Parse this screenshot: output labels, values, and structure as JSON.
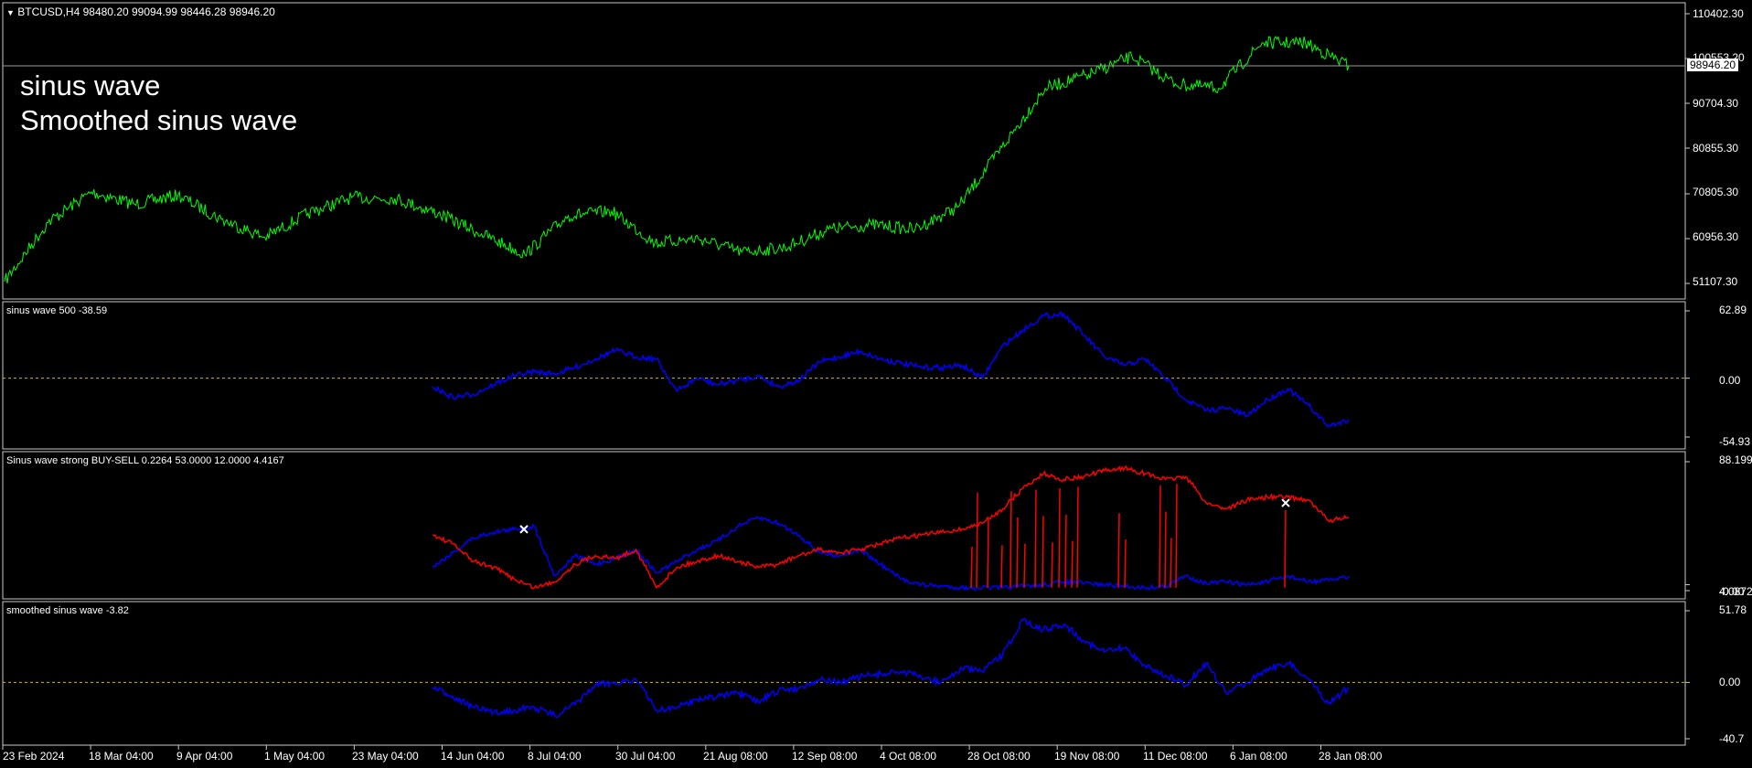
{
  "window": {
    "symbol_line": "BTCUSD,H4  98480.20 99094.99 98446.28 98946.20",
    "overlay_lines": [
      "sinus wave",
      "Smoothed sinus wave"
    ]
  },
  "colors": {
    "background": "#000000",
    "price_line": "#00ff00",
    "blue_line": "#0000ff",
    "red_line": "#ff0000",
    "zero_line": "#d8b800",
    "frame": "#c8c8c8"
  },
  "current_price": "98946.20",
  "price_label_hidden": "100553.20",
  "x_labels": [
    "23 Feb 2024",
    "18 Mar 04:00",
    "9 Apr 04:00",
    "1 May 04:00",
    "23 May 04:00",
    "14 Jun 04:00",
    "8 Jul 04:00",
    "30 Jul 04:00",
    "21 Aug 08:00",
    "12 Sep 08:00",
    "4 Oct 08:00",
    "28 Oct 08:00",
    "19 Nov 08:00",
    "11 Dec 08:00",
    "6 Jan 08:00",
    "28 Jan 08:00"
  ],
  "chart_data": [
    {
      "type": "line",
      "title": "BTCUSD,H4  98480.20 99094.99 98446.28 98946.20",
      "y_ticks": [
        "110402.30",
        "100553.20",
        "90704.30",
        "80855.30",
        "70805.30",
        "60956.30",
        "51107.30"
      ],
      "ylim": [
        51107.3,
        110402.3
      ],
      "series": [
        {
          "name": "BTCUSD",
          "color": "#00ff00",
          "x": [
            "23 Feb 2024",
            "5 Mar",
            "18 Mar",
            "28 Mar",
            "9 Apr",
            "20 Apr",
            "1 May",
            "12 May",
            "23 May",
            "3 Jun",
            "14 Jun",
            "25 Jun",
            "8 Jul",
            "19 Jul",
            "30 Jul",
            "10 Aug",
            "21 Aug",
            "1 Sep",
            "12 Sep",
            "23 Sep",
            "4 Oct",
            "16 Oct",
            "28 Oct",
            "9 Nov",
            "19 Nov",
            "30 Nov",
            "11 Dec",
            "24 Dec",
            "6 Jan",
            "17 Jan",
            "28 Jan",
            "3 Feb"
          ],
          "values": [
            51500,
            64500,
            71200,
            68500,
            70500,
            65200,
            61200,
            66500,
            70000,
            69800,
            66500,
            62000,
            57500,
            66000,
            67000,
            60000,
            61000,
            58000,
            59000,
            63000,
            64000,
            63000,
            68000,
            81000,
            94000,
            97000,
            101000,
            95000,
            94000,
            104000,
            104000,
            98946
          ]
        }
      ]
    },
    {
      "type": "line",
      "title": "sinus wave 500 -38.59",
      "y_ticks": [
        "62.89",
        "0.00",
        "-54.93"
      ],
      "ylim": [
        -54.93,
        62.89
      ],
      "reference_line": 0,
      "series": [
        {
          "name": "sinus wave",
          "color": "#0000ff",
          "x": [
            "12 Jun",
            "16 Jun",
            "21 Jun",
            "24 Jun",
            "28 Jun",
            "3 Jul",
            "8 Jul",
            "13 Jul",
            "17 Jul",
            "22 Jul",
            "27 Jul",
            "30 Jul",
            "4 Aug",
            "10 Aug",
            "16 Aug",
            "21 Aug",
            "27 Aug",
            "3 Sep",
            "8 Sep",
            "14 Sep",
            "21 Sep",
            "28 Sep",
            "4 Oct",
            "10 Oct",
            "17 Oct",
            "22 Oct",
            "28 Oct",
            "1 Nov",
            "8 Nov",
            "15 Nov",
            "19 Nov",
            "26 Nov",
            "1 Dec",
            "5 Dec",
            "11 Dec",
            "17 Dec",
            "24 Dec",
            "31 Dec",
            "6 Jan",
            "10 Jan",
            "15 Jan",
            "20 Jan",
            "25 Jan",
            "29 Jan",
            "1 Feb",
            "3 Feb"
          ],
          "values": [
            -8,
            -18,
            -15,
            -6,
            2,
            6,
            4,
            10,
            18,
            26,
            20,
            18,
            -12,
            0,
            -6,
            -2,
            2,
            -8,
            -2,
            15,
            20,
            25,
            18,
            14,
            10,
            10,
            12,
            0,
            30,
            45,
            58,
            60,
            40,
            20,
            12,
            18,
            0,
            -20,
            -30,
            -28,
            -35,
            -20,
            -10,
            -25,
            -45,
            -38.59
          ]
        }
      ]
    },
    {
      "type": "line",
      "title": "Sinus wave strong BUY-SELL 0.2264 53.0000 12.0000 4.4167",
      "y_ticks": [
        "88.1994",
        "4.0872",
        "-0.00"
      ],
      "ylim": [
        -0.0,
        88.1994
      ],
      "series": [
        {
          "name": "blue",
          "color": "#0000ff",
          "x": [
            "12 Jun",
            "16 Jun",
            "21 Jun",
            "24 Jun",
            "28 Jun",
            "3 Jul",
            "8 Jul",
            "13 Jul",
            "17 Jul",
            "22 Jul",
            "27 Jul",
            "30 Jul",
            "4 Aug",
            "10 Aug",
            "16 Aug",
            "21 Aug",
            "27 Aug",
            "3 Sep",
            "8 Sep",
            "14 Sep",
            "21 Sep",
            "28 Sep",
            "4 Oct",
            "10 Oct",
            "17 Oct",
            "22 Oct",
            "28 Oct",
            "1 Nov",
            "8 Nov",
            "15 Nov",
            "19 Nov",
            "26 Nov",
            "1 Dec",
            "5 Dec",
            "11 Dec",
            "17 Dec",
            "24 Dec",
            "31 Dec",
            "6 Jan",
            "10 Jan",
            "15 Jan",
            "20 Jan",
            "25 Jan",
            "29 Jan",
            "1 Feb",
            "3 Feb"
          ],
          "values": [
            16,
            26,
            36,
            40,
            42,
            44,
            10,
            24,
            18,
            22,
            28,
            12,
            20,
            28,
            34,
            44,
            50,
            46,
            38,
            26,
            24,
            28,
            18,
            8,
            4,
            3,
            2,
            2,
            2,
            3,
            4,
            6,
            5,
            4,
            3,
            2,
            3,
            10,
            5,
            6,
            4,
            6,
            10,
            6,
            7,
            10
          ]
        },
        {
          "name": "red",
          "color": "#ff0000",
          "x": [
            "12 Jun",
            "16 Jun",
            "21 Jun",
            "24 Jun",
            "28 Jun",
            "3 Jul",
            "8 Jul",
            "13 Jul",
            "17 Jul",
            "22 Jul",
            "27 Jul",
            "30 Jul",
            "4 Aug",
            "10 Aug",
            "16 Aug",
            "21 Aug",
            "27 Aug",
            "3 Sep",
            "8 Sep",
            "14 Sep",
            "21 Sep",
            "28 Sep",
            "4 Oct",
            "10 Oct",
            "17 Oct",
            "22 Oct",
            "28 Oct",
            "1 Nov",
            "8 Nov",
            "15 Nov",
            "19 Nov",
            "26 Nov",
            "1 Dec",
            "5 Dec",
            "11 Dec",
            "17 Dec",
            "24 Dec",
            "31 Dec",
            "6 Jan",
            "10 Jan",
            "15 Jan",
            "20 Jan",
            "25 Jan",
            "29 Jan",
            "1 Feb",
            "3 Feb"
          ],
          "values": [
            38,
            32,
            20,
            16,
            8,
            2,
            6,
            18,
            24,
            22,
            28,
            2,
            16,
            20,
            24,
            20,
            16,
            18,
            24,
            28,
            26,
            28,
            32,
            36,
            38,
            40,
            42,
            46,
            56,
            70,
            80,
            76,
            78,
            82,
            84,
            80,
            76,
            78,
            60,
            56,
            62,
            64,
            64,
            62,
            48,
            50
          ]
        }
      ],
      "markers": [
        {
          "x": "7 Jul",
          "value": 42,
          "symbol": "x"
        },
        {
          "x": "13 Jan",
          "value": 60,
          "symbol": "x"
        }
      ]
    },
    {
      "type": "line",
      "title": "smoothed sinus wave -3.82",
      "y_ticks": [
        "51.78",
        "0.00",
        "-40.7"
      ],
      "ylim": [
        -40.7,
        51.78
      ],
      "reference_line": 0,
      "series": [
        {
          "name": "smoothed sinus wave",
          "color": "#0000ff",
          "x": [
            "12 Jun",
            "16 Jun",
            "21 Jun",
            "24 Jun",
            "28 Jun",
            "3 Jul",
            "8 Jul",
            "13 Jul",
            "17 Jul",
            "22 Jul",
            "27 Jul",
            "30 Jul",
            "4 Aug",
            "10 Aug",
            "16 Aug",
            "21 Aug",
            "27 Aug",
            "3 Sep",
            "8 Sep",
            "14 Sep",
            "21 Sep",
            "28 Sep",
            "4 Oct",
            "10 Oct",
            "17 Oct",
            "22 Oct",
            "28 Oct",
            "1 Nov",
            "8 Nov",
            "15 Nov",
            "19 Nov",
            "26 Nov",
            "1 Dec",
            "5 Dec",
            "11 Dec",
            "17 Dec",
            "24 Dec",
            "31 Dec",
            "6 Jan",
            "10 Jan",
            "15 Jan",
            "20 Jan",
            "25 Jan",
            "29 Jan",
            "1 Feb",
            "3 Feb"
          ],
          "values": [
            -4,
            -10,
            -18,
            -22,
            -20,
            -18,
            -24,
            -16,
            -2,
            0,
            2,
            -20,
            -18,
            -12,
            -10,
            -8,
            -14,
            -6,
            -4,
            2,
            0,
            4,
            6,
            8,
            4,
            0,
            10,
            8,
            20,
            45,
            38,
            42,
            30,
            22,
            25,
            12,
            5,
            -2,
            14,
            -8,
            0,
            10,
            14,
            3,
            -15,
            -3.82
          ]
        }
      ]
    }
  ]
}
